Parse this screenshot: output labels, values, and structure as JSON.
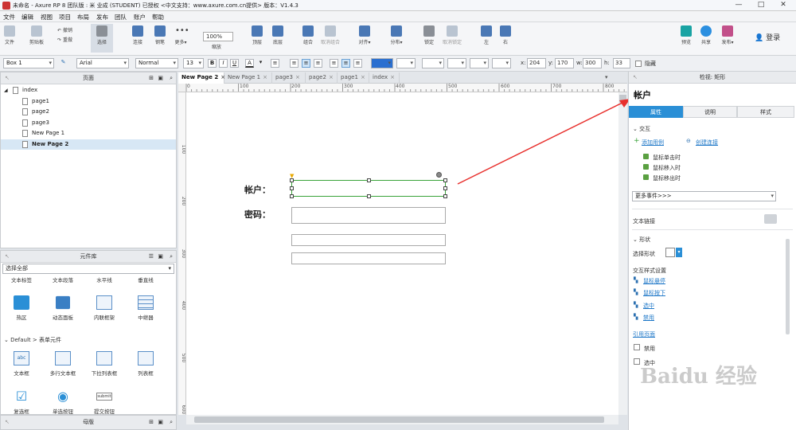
{
  "window": {
    "title": "未命名 - Axure RP 8 团队版 : 米 业成 (STUDENT) 已授权    <中文支持：www.axure.com.cn提供> 版本：V1.4.3",
    "minimize": "—",
    "maximize": "□",
    "close": "✕"
  },
  "menu": [
    "文件",
    "编辑",
    "视图",
    "项目",
    "布局",
    "发布",
    "团队",
    "账户",
    "帮助"
  ],
  "toolbar": {
    "file": "文件",
    "clipboard": "剪贴板",
    "undo": "撤销",
    "redo": "重做",
    "select": "选择",
    "connect": "连接",
    "pen": "钢笔",
    "more": "更多▾",
    "zoom_value": "100%",
    "zoom_label": "缩放",
    "top": "顶层",
    "bottom": "底层",
    "group": "组合",
    "ungroup": "取消组合",
    "align": "对齐▾",
    "distribute": "分布▾",
    "lock": "锁定",
    "unlock": "取消锁定",
    "left": "左",
    "right": "右",
    "preview": "预览",
    "share": "共享",
    "publish": "发布▾",
    "login": "登录"
  },
  "format": {
    "widget_name": "Box 1",
    "font": "Arial",
    "style": "Normal",
    "size": "13",
    "bold": "B",
    "italic": "I",
    "underline": "U",
    "text_color": "A",
    "x_label": "x:",
    "x": "204",
    "y_label": "y:",
    "y": "170",
    "w_label": "w:",
    "w": "300",
    "h_label": "h:",
    "h": "33",
    "hidden": "隐藏"
  },
  "pages_panel": {
    "title": "页面",
    "items": [
      {
        "label": "index",
        "level": 0
      },
      {
        "label": "page1",
        "level": 1
      },
      {
        "label": "page2",
        "level": 1
      },
      {
        "label": "page3",
        "level": 1
      },
      {
        "label": "New Page 1",
        "level": 1
      },
      {
        "label": "New Page 2",
        "level": 1,
        "selected": true
      }
    ]
  },
  "library_panel": {
    "title": "元件库",
    "filter": "选择全部",
    "partial_row": [
      "文本标签",
      "文本段落",
      "水平线",
      "垂直线"
    ],
    "row1": [
      "热区",
      "动态面板",
      "内联框架",
      "中继器"
    ],
    "group2": "Default > 表单元件",
    "row2": [
      "文本框",
      "多行文本框",
      "下拉列表框",
      "列表框"
    ],
    "row3": [
      "复选框",
      "单选按钮",
      "提交按钮"
    ],
    "submit_caption": "submit"
  },
  "masters_panel": {
    "title": "母版"
  },
  "tabs": [
    "New Page 2",
    "New Page 1",
    "page3",
    "page2",
    "page1",
    "index"
  ],
  "ruler_h": [
    "0",
    "100",
    "200",
    "300",
    "400",
    "500",
    "600",
    "700",
    "800"
  ],
  "ruler_v": [
    "100",
    "200",
    "300",
    "400",
    "500",
    "600"
  ],
  "canvas": {
    "account_label": "帐户：",
    "password_label": "密码："
  },
  "inspector": {
    "header": "检视: 矩形",
    "title": "帐户",
    "tabs": [
      "属性",
      "说明",
      "样式"
    ],
    "interaction": "交互",
    "add_case": "添加用例",
    "create_link": "创建连接",
    "events": [
      "鼠标单击时",
      "鼠标移入时",
      "鼠标移出时"
    ],
    "more_events": "更多事件>>>",
    "text_link": "文本链接",
    "shape_section": "形状",
    "select_shape": "选择形状",
    "interaction_styles": "交互样式设置",
    "style_links": [
      "鼠标悬停",
      "鼠标按下",
      "选中",
      "禁用"
    ],
    "reference_page": "引用页面",
    "disabled": "禁用",
    "selected": "选中",
    "watermark": "Baidu 经验"
  },
  "colors": {
    "accent": "#2a8fd6",
    "selection_green": "#3aa33a",
    "arrow_red": "#e8302d"
  }
}
